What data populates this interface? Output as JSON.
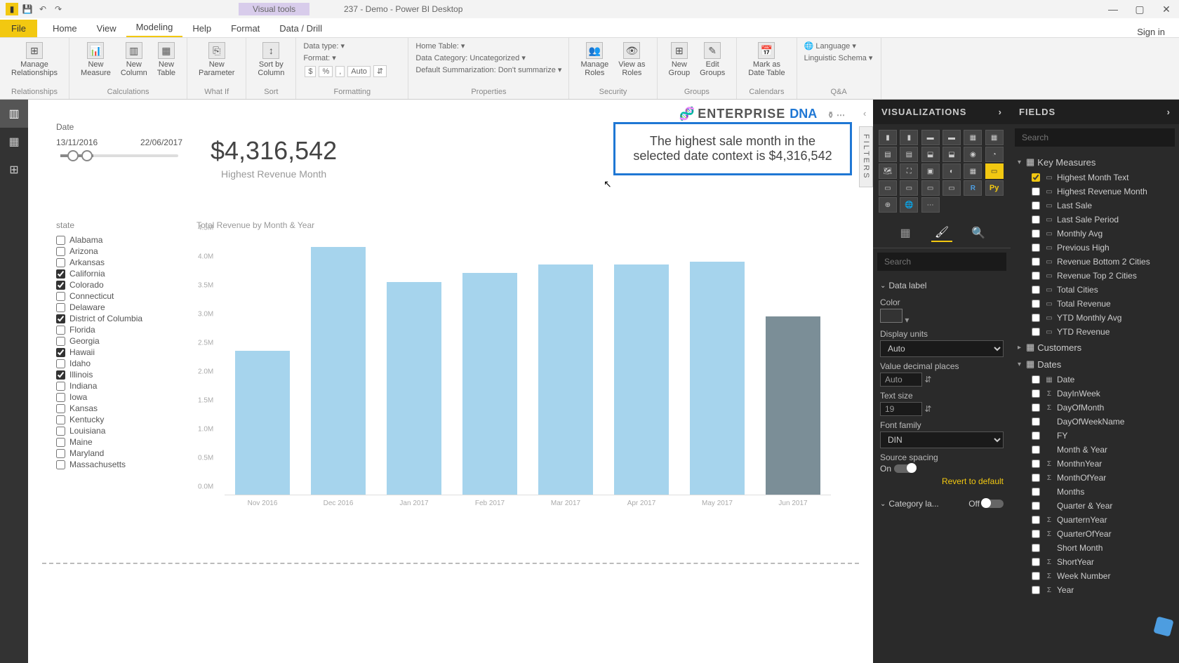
{
  "titlebar": {
    "visual_tools": "Visual tools",
    "doc": "237 - Demo - Power BI Desktop"
  },
  "menu": {
    "file": "File",
    "items": [
      "Home",
      "View",
      "Modeling",
      "Help",
      "Format",
      "Data / Drill"
    ],
    "active": "Modeling",
    "signin": "Sign in"
  },
  "ribbon": {
    "relationships": {
      "label": "Relationships",
      "btn": "Manage\nRelationships"
    },
    "calculations": {
      "label": "Calculations",
      "btns": [
        "New\nMeasure",
        "New\nColumn",
        "New\nTable"
      ]
    },
    "whatif": {
      "label": "What If",
      "btn": "New\nParameter"
    },
    "sort": {
      "label": "Sort",
      "btn": "Sort by\nColumn"
    },
    "formatting": {
      "label": "Formatting",
      "data_type": "Data type:",
      "format": "Format:",
      "auto": "Auto"
    },
    "properties": {
      "label": "Properties",
      "home_table": "Home Table:",
      "category": "Data Category: Uncategorized",
      "summarization": "Default Summarization: Don't summarize"
    },
    "security": {
      "label": "Security",
      "btns": [
        "Manage\nRoles",
        "View as\nRoles"
      ]
    },
    "groups": {
      "label": "Groups",
      "btns": [
        "New\nGroup",
        "Edit\nGroups"
      ]
    },
    "calendars": {
      "label": "Calendars",
      "btn": "Mark as\nDate Table"
    },
    "qa": {
      "label": "Q&A",
      "language": "Language",
      "schema": "Linguistic Schema"
    }
  },
  "canvas": {
    "date_slicer": {
      "title": "Date",
      "from": "13/11/2016",
      "to": "22/06/2017"
    },
    "kpi": {
      "value": "$4,316,542",
      "label": "Highest Revenue Month"
    },
    "narrative": "The highest sale month in the selected date context is $4,316,542",
    "logo": {
      "ent": "ENTERPRISE ",
      "dna": "DNA"
    },
    "state": {
      "title": "state",
      "items": [
        {
          "name": "Alabama",
          "checked": false
        },
        {
          "name": "Arizona",
          "checked": false
        },
        {
          "name": "Arkansas",
          "checked": false
        },
        {
          "name": "California",
          "checked": true
        },
        {
          "name": "Colorado",
          "checked": true
        },
        {
          "name": "Connecticut",
          "checked": false
        },
        {
          "name": "Delaware",
          "checked": false
        },
        {
          "name": "District of Columbia",
          "checked": true
        },
        {
          "name": "Florida",
          "checked": false
        },
        {
          "name": "Georgia",
          "checked": false
        },
        {
          "name": "Hawaii",
          "checked": true
        },
        {
          "name": "Idaho",
          "checked": false
        },
        {
          "name": "Illinois",
          "checked": true
        },
        {
          "name": "Indiana",
          "checked": false
        },
        {
          "name": "Iowa",
          "checked": false
        },
        {
          "name": "Kansas",
          "checked": false
        },
        {
          "name": "Kentucky",
          "checked": false
        },
        {
          "name": "Louisiana",
          "checked": false
        },
        {
          "name": "Maine",
          "checked": false
        },
        {
          "name": "Maryland",
          "checked": false
        },
        {
          "name": "Massachusetts",
          "checked": false
        }
      ]
    }
  },
  "chart_data": {
    "type": "bar",
    "title": "Total Revenue by Month & Year",
    "ylabel": "",
    "ylim": [
      0,
      4500000
    ],
    "yticks": [
      "0.0M",
      "0.5M",
      "1.0M",
      "1.5M",
      "2.0M",
      "2.5M",
      "3.0M",
      "3.5M",
      "4.0M",
      "4.5M"
    ],
    "categories": [
      "Nov 2016",
      "Dec 2016",
      "Jan 2017",
      "Feb 2017",
      "Mar 2017",
      "Apr 2017",
      "May 2017",
      "Jun 2017"
    ],
    "values": [
      2500000,
      4300000,
      3700000,
      3850000,
      4000000,
      4000000,
      4050000,
      3100000
    ],
    "highlight_index": 7
  },
  "viz": {
    "header": "VISUALIZATIONS",
    "search_placeholder": "Search",
    "format": {
      "data_label": "Data label",
      "color": "Color",
      "display_units": "Display units",
      "display_units_val": "Auto",
      "decimal": "Value decimal places",
      "decimal_val": "Auto",
      "text_size": "Text size",
      "text_size_val": "19",
      "font_family": "Font family",
      "font_family_val": "DIN",
      "source_spacing": "Source spacing",
      "on": "On",
      "category": "Category la...",
      "off": "Off",
      "revert": "Revert to default"
    }
  },
  "fields": {
    "header": "FIELDS",
    "search_placeholder": "Search",
    "groups": [
      {
        "name": "Key Measures",
        "expanded": true,
        "items": [
          {
            "name": "Highest Month Text",
            "checked": true,
            "icon": "▭"
          },
          {
            "name": "Highest Revenue Month",
            "checked": false,
            "icon": "▭"
          },
          {
            "name": "Last Sale",
            "checked": false,
            "icon": "▭"
          },
          {
            "name": "Last Sale Period",
            "checked": false,
            "icon": "▭"
          },
          {
            "name": "Monthly Avg",
            "checked": false,
            "icon": "▭"
          },
          {
            "name": "Previous High",
            "checked": false,
            "icon": "▭"
          },
          {
            "name": "Revenue Bottom 2 Cities",
            "checked": false,
            "icon": "▭"
          },
          {
            "name": "Revenue Top 2 Cities",
            "checked": false,
            "icon": "▭"
          },
          {
            "name": "Total Cities",
            "checked": false,
            "icon": "▭"
          },
          {
            "name": "Total Revenue",
            "checked": false,
            "icon": "▭"
          },
          {
            "name": "YTD Monthly Avg",
            "checked": false,
            "icon": "▭"
          },
          {
            "name": "YTD Revenue",
            "checked": false,
            "icon": "▭"
          }
        ]
      },
      {
        "name": "Customers",
        "expanded": false,
        "items": []
      },
      {
        "name": "Dates",
        "expanded": true,
        "items": [
          {
            "name": "Date",
            "checked": false,
            "icon": "▦"
          },
          {
            "name": "DayInWeek",
            "checked": false,
            "icon": "Σ"
          },
          {
            "name": "DayOfMonth",
            "checked": false,
            "icon": "Σ"
          },
          {
            "name": "DayOfWeekName",
            "checked": false,
            "icon": ""
          },
          {
            "name": "FY",
            "checked": false,
            "icon": ""
          },
          {
            "name": "Month & Year",
            "checked": false,
            "icon": ""
          },
          {
            "name": "MonthnYear",
            "checked": false,
            "icon": "Σ"
          },
          {
            "name": "MonthOfYear",
            "checked": false,
            "icon": "Σ"
          },
          {
            "name": "Months",
            "checked": false,
            "icon": ""
          },
          {
            "name": "Quarter & Year",
            "checked": false,
            "icon": ""
          },
          {
            "name": "QuarternYear",
            "checked": false,
            "icon": "Σ"
          },
          {
            "name": "QuarterOfYear",
            "checked": false,
            "icon": "Σ"
          },
          {
            "name": "Short Month",
            "checked": false,
            "icon": ""
          },
          {
            "name": "ShortYear",
            "checked": false,
            "icon": "Σ"
          },
          {
            "name": "Week Number",
            "checked": false,
            "icon": "Σ"
          },
          {
            "name": "Year",
            "checked": false,
            "icon": "Σ"
          }
        ]
      }
    ]
  },
  "filters_label": "FILTERS"
}
